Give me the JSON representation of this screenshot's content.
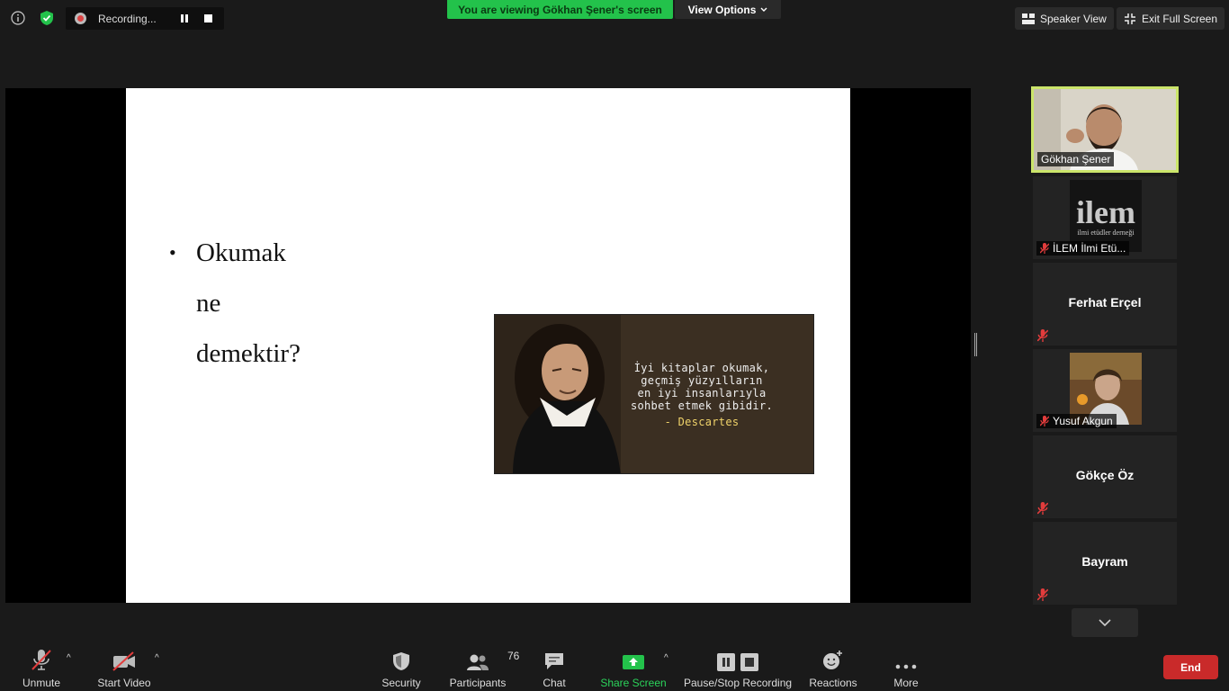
{
  "recording": {
    "label": "Recording..."
  },
  "banner": {
    "viewing": "You are viewing Gökhan Şener's screen",
    "view_options": "View Options"
  },
  "top_right": {
    "speaker_view": "Speaker View",
    "exit_full_screen": "Exit Full Screen"
  },
  "slide": {
    "bullet_lines": [
      "Okumak",
      "ne",
      "demektir?"
    ],
    "quote_lines": [
      "İyi kitaplar okumak,",
      "geçmiş yüzyılların",
      "en iyi insanlarıyla",
      "sohbet etmek gibidir."
    ],
    "quote_author": "- Descartes"
  },
  "participants": [
    {
      "name": "Gökhan Şener",
      "active": true,
      "muted": false,
      "has_video": true
    },
    {
      "name": "İLEM İlmi Etü...",
      "logo_text": "ilem",
      "logo_sub": "ilmi etüdler derneği",
      "muted": true,
      "has_video": true
    },
    {
      "name": "Ferhat Erçel",
      "muted": true,
      "has_video": false
    },
    {
      "name": "Yusuf Akgun",
      "muted": true,
      "has_video": true
    },
    {
      "name": "Gökçe Öz",
      "muted": true,
      "has_video": false
    },
    {
      "name": "Bayram",
      "muted": true,
      "has_video": false
    }
  ],
  "toolbar": {
    "unmute": "Unmute",
    "start_video": "Start Video",
    "security": "Security",
    "participants": "Participants",
    "participants_count": "76",
    "chat": "Chat",
    "share_screen": "Share Screen",
    "pause_stop_recording": "Pause/Stop Recording",
    "reactions": "Reactions",
    "more": "More",
    "end": "End"
  },
  "colors": {
    "banner_green": "#23c24b",
    "active_speaker_border": "#cbe56a",
    "end_red": "#c92a2a",
    "share_green": "#23c24b",
    "mute_red": "#e23c3c"
  }
}
